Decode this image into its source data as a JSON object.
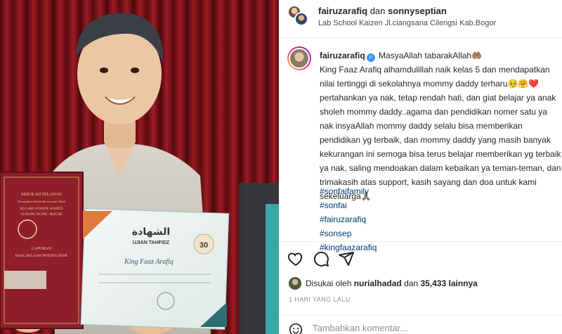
{
  "photo": {
    "alt": "",
    "book_cover": {
      "line1": "SEKOLAH TELADAN",
      "line2": "Terwujudnya Sekolah Berwawasan Global",
      "line3": "SD LABS SCHOOL KAIZEN",
      "line4": "GUNUNG PUTRI - BOGOR",
      "line5": "LAPORAN",
      "line6": "HASIL BELAJAR PESERTA DIDIK"
    },
    "certificate": {
      "arabic_title": "الشهادة",
      "subtitle": "UJIAN TAHFIDZ",
      "score": "30",
      "recipient": "King Faaz Arafiq"
    }
  },
  "header": {
    "user1": "fairuzarafiq",
    "connector": "dan",
    "user2": "sonnyseptian",
    "location": "Lab School Kaizen Jl.ciangsana Cilengsi Kab.Bogor"
  },
  "caption": {
    "username": "fairuzarafiq",
    "verified_icon": "✓",
    "lines": [
      "MasyaAllah tabarakAllah🤲🏽",
      "King Faaz Arafiq alhamdulillah naik kelas 5 dan mendapatkan",
      "nilai tertinggi di sekolahnya mommy daddy terharu🥺🤗❤️",
      "pertahankan ya nak, tetap rendah hati, dan giat belajar ya anak",
      "sholeh mommy daddy..agama dan pendidikan nomer satu ya",
      "nak insyaAllah mommy daddy selalu bisa memberikan",
      "pendidikan yg terbaik, dan mommy daddy yang masih banyak",
      "kekurangan ini semoga bisa terus belajar memberikan yg terbaik",
      "ya nak, saling mendoakan dalam kebaikan ya teman-teman, dan",
      "trimakasih atas support, kasih sayang dan doa untuk kami",
      "sekeluarga🙏🏽"
    ],
    "hashtags": [
      "#sonfaifamily",
      "#sonfai",
      "#fairuzarafiq",
      "#sonsep",
      "#kingfaazarafiq"
    ]
  },
  "actions": {
    "like_icon": "heart-icon",
    "comment_icon": "comment-icon",
    "share_icon": "share-icon"
  },
  "likes": {
    "prefix": "Disukai oleh",
    "user": "nurialhadad",
    "middle": "dan",
    "count": "35,433 lainnya"
  },
  "timestamp": "1 HARI YANG LALU",
  "comment": {
    "placeholder": "Tambahkan komentar..."
  },
  "colors": {
    "link": "#00376b",
    "verified": "#3897f0",
    "muted": "#8e8e8e",
    "curtain": "#7a1018"
  }
}
